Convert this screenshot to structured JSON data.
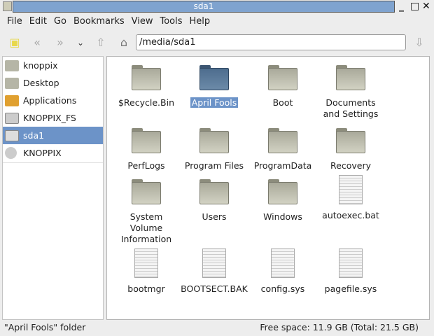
{
  "window": {
    "title": "sda1"
  },
  "menu": [
    "File",
    "Edit",
    "Go",
    "Bookmarks",
    "View",
    "Tools",
    "Help"
  ],
  "location": {
    "path": "/media/sda1"
  },
  "sidebar": {
    "items": [
      {
        "label": "knoppix",
        "icon": "home-folder-icon"
      },
      {
        "label": "Desktop",
        "icon": "desktop-folder-icon"
      },
      {
        "label": "Applications",
        "icon": "applications-icon"
      },
      {
        "label": "KNOPPIX_FS",
        "icon": "drive-icon"
      },
      {
        "label": "sda1",
        "icon": "drive-icon",
        "selected": true
      },
      {
        "label": "KNOPPIX",
        "icon": "cdrom-icon"
      }
    ]
  },
  "files": [
    {
      "name": "$Recycle.Bin",
      "type": "folder"
    },
    {
      "name": "April Fools",
      "type": "folder",
      "selected": true
    },
    {
      "name": "Boot",
      "type": "folder"
    },
    {
      "name": "Documents and Settings",
      "type": "folder-link"
    },
    {
      "name": "PerfLogs",
      "type": "folder"
    },
    {
      "name": "Program Files",
      "type": "folder"
    },
    {
      "name": "ProgramData",
      "type": "folder"
    },
    {
      "name": "Recovery",
      "type": "folder"
    },
    {
      "name": "System Volume Information",
      "type": "folder"
    },
    {
      "name": "Users",
      "type": "folder"
    },
    {
      "name": "Windows",
      "type": "folder"
    },
    {
      "name": "autoexec.bat",
      "type": "file"
    },
    {
      "name": "bootmgr",
      "type": "file"
    },
    {
      "name": "BOOTSECT.BAK",
      "type": "file"
    },
    {
      "name": "config.sys",
      "type": "file"
    },
    {
      "name": "pagefile.sys",
      "type": "file"
    }
  ],
  "status": {
    "left": "\"April Fools\" folder",
    "right": "Free space: 11.9 GB (Total: 21.5 GB)"
  }
}
